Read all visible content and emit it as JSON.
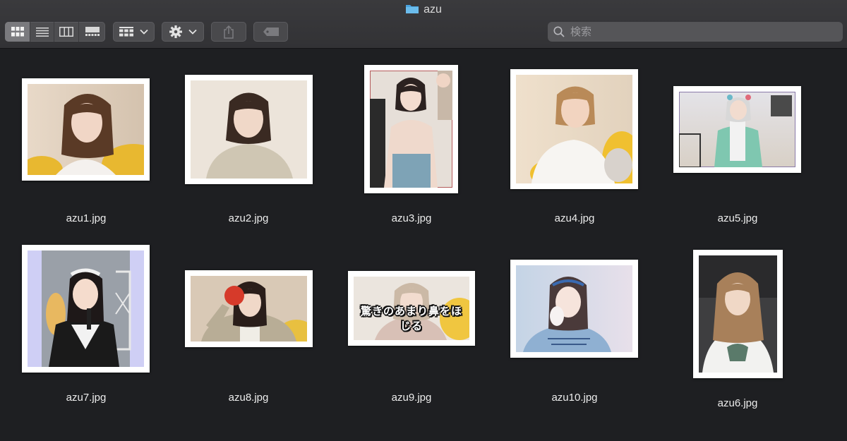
{
  "window": {
    "title": "azu",
    "folder_icon": "folder-icon",
    "accent": "#4aa3df"
  },
  "toolbar": {
    "view_modes": [
      {
        "name": "icon-view",
        "icon": "grid-icon",
        "active": true
      },
      {
        "name": "list-view",
        "icon": "list-icon",
        "active": false
      },
      {
        "name": "column-view",
        "icon": "columns-icon",
        "active": false
      },
      {
        "name": "gallery-view",
        "icon": "gallery-icon",
        "active": false
      }
    ],
    "group_icon": "group-grid-icon",
    "action_icon": "gear-icon",
    "share_icon": "share-icon",
    "tag_icon": "tag-icon",
    "search_placeholder": "検索"
  },
  "files": [
    {
      "name": "azu1.jpg",
      "bg": "#d9c8b6"
    },
    {
      "name": "azu2.jpg",
      "bg": "#e6ddd2"
    },
    {
      "name": "azu3.jpg",
      "bg": "#e3dbd4"
    },
    {
      "name": "azu4.jpg",
      "bg": "#e8d9c4"
    },
    {
      "name": "azu5.jpg",
      "bg": "#dfe1e6"
    },
    {
      "name": "azu7.jpg",
      "bg": "#c8c8f2"
    },
    {
      "name": "azu8.jpg",
      "bg": "#d6c6b3"
    },
    {
      "name": "azu9.jpg",
      "bg": "#e4ddd6",
      "caption": "驚きのあまり鼻をほじる"
    },
    {
      "name": "azu10.jpg",
      "bg": "#d6dde8"
    },
    {
      "name": "azu6.jpg",
      "bg": "#3a3a3c"
    }
  ]
}
